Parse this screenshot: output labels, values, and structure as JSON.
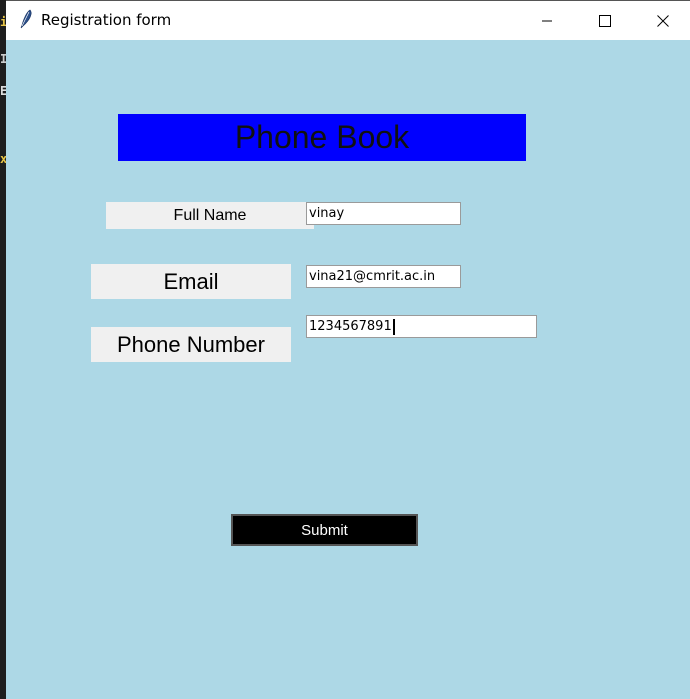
{
  "window": {
    "title": "Registration form",
    "icon": "feather-icon",
    "background_color": "#add8e6"
  },
  "titlebar_controls": [
    "minimize-icon",
    "maximize-icon",
    "close-icon"
  ],
  "background_strip": {
    "chars": [
      "i",
      "I",
      "E",
      "x."
    ]
  },
  "form": {
    "heading": "Phone Book",
    "heading_bg": "#0000ff",
    "full_name_label": "Full Name",
    "full_name_value": "vinay",
    "email_label": "Email",
    "email_value": "vina21@cmrit.ac.in",
    "phone_label": "Phone Number",
    "phone_value": "1234567891",
    "submit_label": "Submit",
    "submit_bg": "#000000"
  }
}
